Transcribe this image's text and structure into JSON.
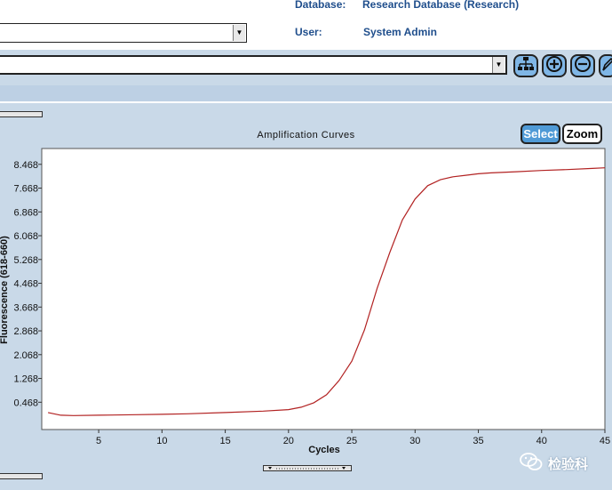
{
  "header": {
    "database_label": "Database:",
    "database_value": "Research Database (Research)",
    "user_label": "User:",
    "user_value": "System Admin"
  },
  "toolbar": {
    "icons": [
      "network-icon",
      "zoom-in-icon",
      "zoom-out-icon",
      "pencil-icon"
    ]
  },
  "chart": {
    "title": "Amplification Curves",
    "select_label": "Select",
    "zoom_label": "Zoom"
  },
  "watermark": {
    "text": "检验科"
  },
  "colors": {
    "curve": "#b22222",
    "accent": "#4f9ad6",
    "background": "#c9d9e8"
  },
  "chart_data": {
    "type": "line",
    "title": "Amplification Curves",
    "xlabel": "Cycles",
    "ylabel": "Fluorescence (618-660)",
    "xlim": [
      0.5,
      45
    ],
    "ylim": [
      -0.45,
      9.0
    ],
    "x_ticks": [
      5,
      10,
      15,
      20,
      25,
      30,
      35,
      40,
      45
    ],
    "y_ticks": [
      0.468,
      1.268,
      2.068,
      2.868,
      3.668,
      4.468,
      5.268,
      6.068,
      6.868,
      7.668,
      8.468
    ],
    "grid": false,
    "legend": "none",
    "series": [
      {
        "x": [
          1,
          2,
          3,
          5,
          8,
          10,
          12,
          15,
          18,
          20,
          21,
          22,
          23,
          24,
          25,
          26,
          27,
          28,
          29,
          30,
          31,
          32,
          33,
          34,
          35,
          36,
          38,
          40,
          42,
          44,
          45
        ],
        "y": [
          0.12,
          0.03,
          0.02,
          0.03,
          0.05,
          0.06,
          0.08,
          0.12,
          0.17,
          0.22,
          0.3,
          0.45,
          0.72,
          1.2,
          1.85,
          2.9,
          4.3,
          5.5,
          6.6,
          7.3,
          7.75,
          7.95,
          8.05,
          8.1,
          8.15,
          8.18,
          8.22,
          8.26,
          8.29,
          8.33,
          8.35
        ]
      }
    ]
  }
}
